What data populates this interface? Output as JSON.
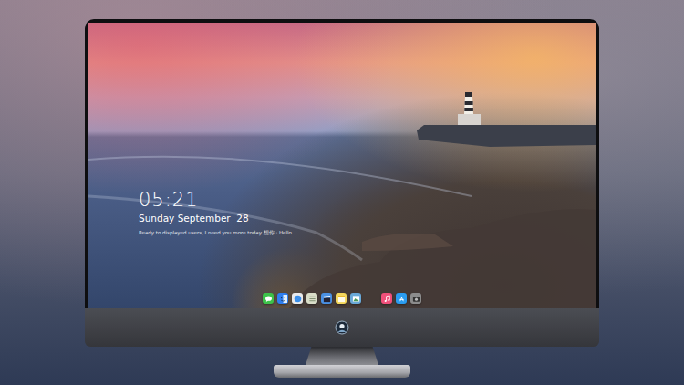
{
  "screen": {
    "clock": {
      "time": "05:21",
      "date": "Sunday September  28",
      "message": "Ready to displayed users, I need you more today 想你 · Hello"
    },
    "dock": {
      "apps": [
        {
          "kind": "messages",
          "color": "#3dc24a"
        },
        {
          "kind": "finder",
          "color": "#2e7ff0"
        },
        {
          "kind": "safari",
          "color": "#e9e9e9"
        },
        {
          "kind": "reminders",
          "color": "#d9ddc8"
        },
        {
          "kind": "clapper",
          "color": "#4a90e2"
        },
        {
          "kind": "notes",
          "color": "#f5d75a"
        },
        {
          "kind": "preview",
          "color": "#6aa9d8"
        },
        {
          "kind": "separator",
          "color": "#000000"
        },
        {
          "kind": "music",
          "color": "#f0507a"
        },
        {
          "kind": "appstore",
          "color": "#2a9cf0"
        },
        {
          "kind": "camera",
          "color": "#8c8c8c"
        }
      ]
    }
  }
}
